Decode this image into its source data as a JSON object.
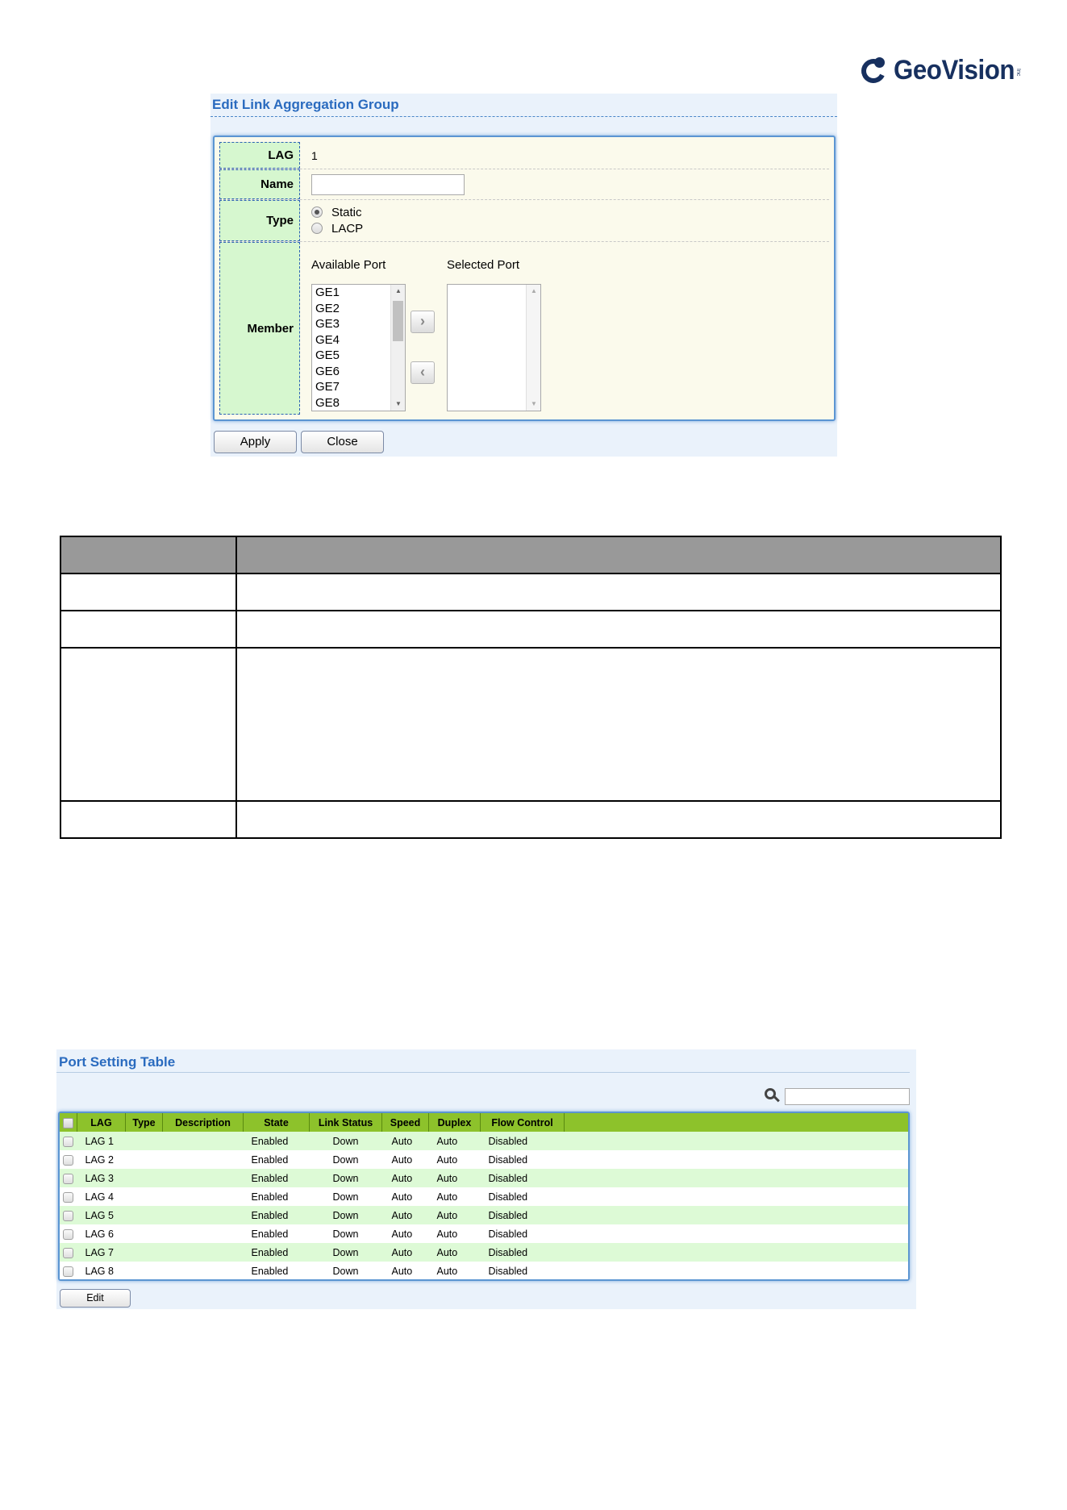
{
  "logo": {
    "brand": "GeoVision",
    "suffix": "Inc"
  },
  "edit_dialog": {
    "title": "Edit Link Aggregation Group",
    "rows": {
      "lag": {
        "label": "LAG",
        "value": "1"
      },
      "name": {
        "label": "Name",
        "value": ""
      },
      "type": {
        "label": "Type",
        "options": [
          "Static",
          "LACP"
        ],
        "selected": "Static"
      },
      "member": {
        "label": "Member",
        "available_header": "Available Port",
        "selected_header": "Selected Port",
        "available_ports": [
          "GE1",
          "GE2",
          "GE3",
          "GE4",
          "GE5",
          "GE6",
          "GE7",
          "GE8"
        ],
        "selected_ports": [],
        "move_right_glyph": "›",
        "move_left_glyph": "‹"
      }
    },
    "apply_label": "Apply",
    "close_label": "Close"
  },
  "port_table": {
    "title": "Port Setting Table",
    "search_value": "",
    "columns": [
      "LAG",
      "Type",
      "Description",
      "State",
      "Link Status",
      "Speed",
      "Duplex",
      "Flow Control"
    ],
    "rows": [
      {
        "lag": "LAG 1",
        "type": "",
        "description": "",
        "state": "Enabled",
        "link_status": "Down",
        "speed": "Auto",
        "duplex": "Auto",
        "flow_control": "Disabled"
      },
      {
        "lag": "LAG 2",
        "type": "",
        "description": "",
        "state": "Enabled",
        "link_status": "Down",
        "speed": "Auto",
        "duplex": "Auto",
        "flow_control": "Disabled"
      },
      {
        "lag": "LAG 3",
        "type": "",
        "description": "",
        "state": "Enabled",
        "link_status": "Down",
        "speed": "Auto",
        "duplex": "Auto",
        "flow_control": "Disabled"
      },
      {
        "lag": "LAG 4",
        "type": "",
        "description": "",
        "state": "Enabled",
        "link_status": "Down",
        "speed": "Auto",
        "duplex": "Auto",
        "flow_control": "Disabled"
      },
      {
        "lag": "LAG 5",
        "type": "",
        "description": "",
        "state": "Enabled",
        "link_status": "Down",
        "speed": "Auto",
        "duplex": "Auto",
        "flow_control": "Disabled"
      },
      {
        "lag": "LAG 6",
        "type": "",
        "description": "",
        "state": "Enabled",
        "link_status": "Down",
        "speed": "Auto",
        "duplex": "Auto",
        "flow_control": "Disabled"
      },
      {
        "lag": "LAG 7",
        "type": "",
        "description": "",
        "state": "Enabled",
        "link_status": "Down",
        "speed": "Auto",
        "duplex": "Auto",
        "flow_control": "Disabled"
      },
      {
        "lag": "LAG 8",
        "type": "",
        "description": "",
        "state": "Enabled",
        "link_status": "Down",
        "speed": "Auto",
        "duplex": "Auto",
        "flow_control": "Disabled"
      }
    ],
    "edit_label": "Edit"
  }
}
